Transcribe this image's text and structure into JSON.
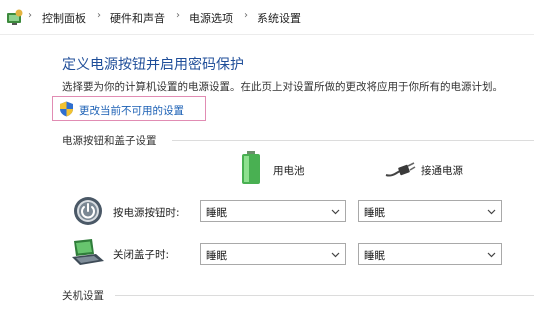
{
  "breadcrumb": {
    "items": [
      "控制面板",
      "硬件和声音",
      "电源选项",
      "系统设置"
    ]
  },
  "page": {
    "title": "定义电源按钮并启用密码保护",
    "description": "选择要为你的计算机设置的电源设置。在此页上对设置所做的更改将应用于你所有的电源计划。",
    "change_link": "更改当前不可用的设置"
  },
  "power_section": {
    "label": "电源按钮和盖子设置",
    "columns": {
      "battery": "用电池",
      "plugged_in": "接通电源"
    },
    "rows": [
      {
        "label": "按电源按钮时:",
        "battery_value": "睡眠",
        "plugged_value": "睡眠",
        "icon": "power-button-icon"
      },
      {
        "label": "关闭盖子时:",
        "battery_value": "睡眠",
        "plugged_value": "睡眠",
        "icon": "laptop-lid-icon"
      }
    ]
  },
  "shutdown_section": {
    "label": "关机设置"
  },
  "colors": {
    "title": "#1f4e99",
    "link": "#1a5fb4",
    "highlight_box": "#e18cb3",
    "battery_green": "#3fa34d"
  }
}
